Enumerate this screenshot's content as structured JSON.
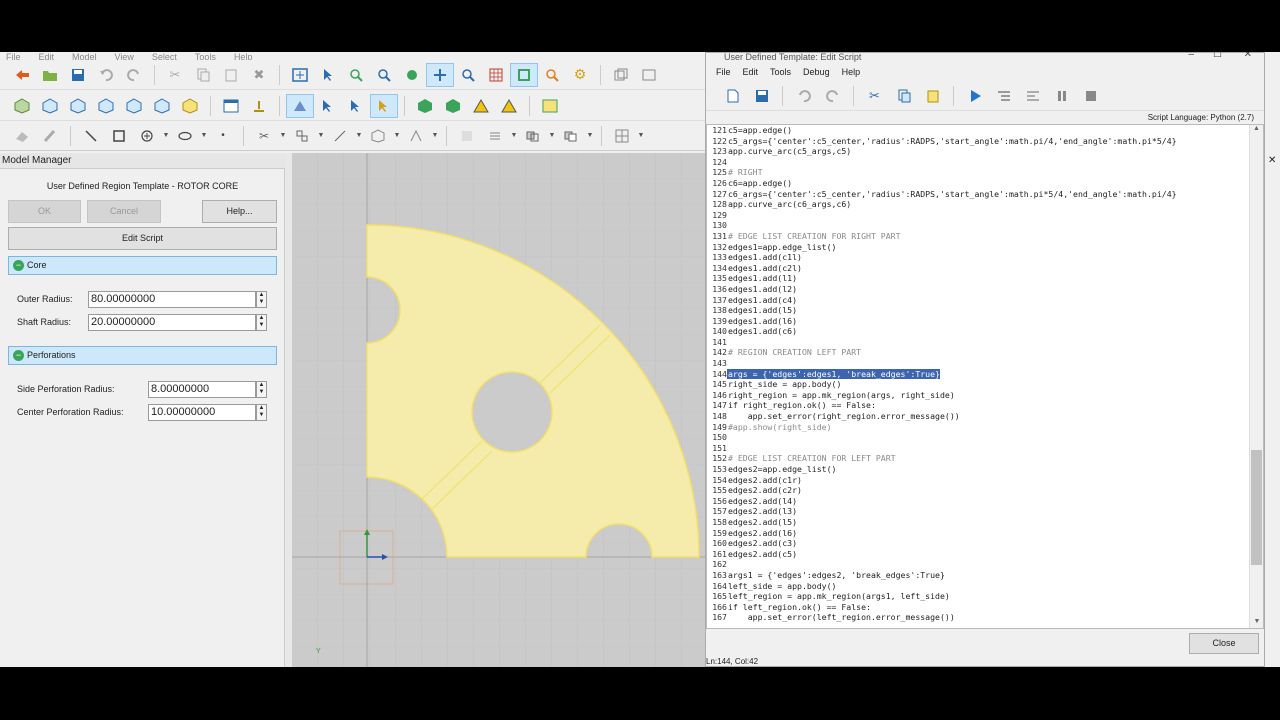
{
  "app": {
    "menu": [
      "File",
      "Edit",
      "Model",
      "View",
      "Select",
      "Tools",
      "Help"
    ]
  },
  "model_manager": {
    "title": "Model Manager",
    "subtitle": "User Defined Region Template - ROTOR CORE",
    "ok": "OK",
    "cancel": "Cancel",
    "help": "Help...",
    "edit_script": "Edit Script",
    "core_label": "Core",
    "outer_radius_label": "Outer Radius:",
    "outer_radius_value": "80.00000000",
    "shaft_radius_label": "Shaft Radius:",
    "shaft_radius_value": "20.00000000",
    "perforations_label": "Perforations",
    "side_perf_label": "Side Perforation Radius:",
    "side_perf_value": "8.00000000",
    "center_perf_label": "Center Perforation Radius:",
    "center_perf_value": "10.00000000"
  },
  "viewport": {
    "axis_y": "Y",
    "fill_color": "#f5ecac",
    "edge_color": "#f2e06a"
  },
  "dialog": {
    "title": "User Defined Template: Edit Script",
    "menu": [
      "File",
      "Edit",
      "Tools",
      "Debug",
      "Help"
    ],
    "language": "Script Language: Python (2.7)",
    "status": "Ln:144, Col:42",
    "close": "Close"
  },
  "code_lines": [
    {
      "n": "121",
      "t": "c5=app.edge()",
      "k": "code"
    },
    {
      "n": "122",
      "t": "c5_args={'center':c5_center,'radius':RADPS,'start_angle':math.pi/4,'end_angle':math.pi*5/4}",
      "k": "code"
    },
    {
      "n": "123",
      "t": "app.curve_arc(c5_args,c5)",
      "k": "code"
    },
    {
      "n": "124",
      "t": "",
      "k": "code"
    },
    {
      "n": "125",
      "t": "# RIGHT",
      "k": "cmt"
    },
    {
      "n": "126",
      "t": "c6=app.edge()",
      "k": "code"
    },
    {
      "n": "127",
      "t": "c6_args={'center':c5_center,'radius':RADPS,'start_angle':math.pi*5/4,'end_angle':math.pi/4}",
      "k": "code"
    },
    {
      "n": "128",
      "t": "app.curve_arc(c6_args,c6)",
      "k": "code"
    },
    {
      "n": "129",
      "t": "",
      "k": "code"
    },
    {
      "n": "130",
      "t": "",
      "k": "code"
    },
    {
      "n": "131",
      "t": "# EDGE LIST CREATION FOR RIGHT PART",
      "k": "cmt"
    },
    {
      "n": "132",
      "t": "edges1=app.edge_list()",
      "k": "code"
    },
    {
      "n": "133",
      "t": "edges1.add(c1l)",
      "k": "code"
    },
    {
      "n": "134",
      "t": "edges1.add(c2l)",
      "k": "code"
    },
    {
      "n": "135",
      "t": "edges1.add(l1)",
      "k": "code"
    },
    {
      "n": "136",
      "t": "edges1.add(l2)",
      "k": "code"
    },
    {
      "n": "137",
      "t": "edges1.add(c4)",
      "k": "code"
    },
    {
      "n": "138",
      "t": "edges1.add(l5)",
      "k": "code"
    },
    {
      "n": "139",
      "t": "edges1.add(l6)",
      "k": "code"
    },
    {
      "n": "140",
      "t": "edges1.add(c6)",
      "k": "code"
    },
    {
      "n": "141",
      "t": "",
      "k": "code"
    },
    {
      "n": "142",
      "t": "# REGION CREATION LEFT PART",
      "k": "cmt"
    },
    {
      "n": "143",
      "t": "",
      "k": "code"
    },
    {
      "n": "144",
      "t": "args = {'edges':edges1, 'break_edges':True}",
      "k": "hl"
    },
    {
      "n": "145",
      "t": "right_side = app.body()",
      "k": "code"
    },
    {
      "n": "146",
      "t": "right_region = app.mk_region(args, right_side)",
      "k": "code"
    },
    {
      "n": "147",
      "t": "if right_region.ok() == False:",
      "k": "code"
    },
    {
      "n": "148",
      "t": "    app.set_error(right_region.error_message())",
      "k": "code"
    },
    {
      "n": "149",
      "t": "#app.show(right_side)",
      "k": "cmt"
    },
    {
      "n": "150",
      "t": "",
      "k": "code"
    },
    {
      "n": "151",
      "t": "",
      "k": "code"
    },
    {
      "n": "152",
      "t": "# EDGE LIST CREATION FOR LEFT PART",
      "k": "cmt"
    },
    {
      "n": "153",
      "t": "edges2=app.edge_list()",
      "k": "code"
    },
    {
      "n": "154",
      "t": "edges2.add(c1r)",
      "k": "code"
    },
    {
      "n": "155",
      "t": "edges2.add(c2r)",
      "k": "code"
    },
    {
      "n": "156",
      "t": "edges2.add(l4)",
      "k": "code"
    },
    {
      "n": "157",
      "t": "edges2.add(l3)",
      "k": "code"
    },
    {
      "n": "158",
      "t": "edges2.add(l5)",
      "k": "code"
    },
    {
      "n": "159",
      "t": "edges2.add(l6)",
      "k": "code"
    },
    {
      "n": "160",
      "t": "edges2.add(c3)",
      "k": "code"
    },
    {
      "n": "161",
      "t": "edges2.add(c5)",
      "k": "code"
    },
    {
      "n": "162",
      "t": "",
      "k": "code"
    },
    {
      "n": "163",
      "t": "args1 = {'edges':edges2, 'break_edges':True}",
      "k": "code"
    },
    {
      "n": "164",
      "t": "left_side = app.body()",
      "k": "code"
    },
    {
      "n": "165",
      "t": "left_region = app.mk_region(args1, left_side)",
      "k": "code"
    },
    {
      "n": "166",
      "t": "if left_region.ok() == False:",
      "k": "code"
    },
    {
      "n": "167",
      "t": "    app.set_error(left_region.error_message())",
      "k": "code"
    }
  ]
}
